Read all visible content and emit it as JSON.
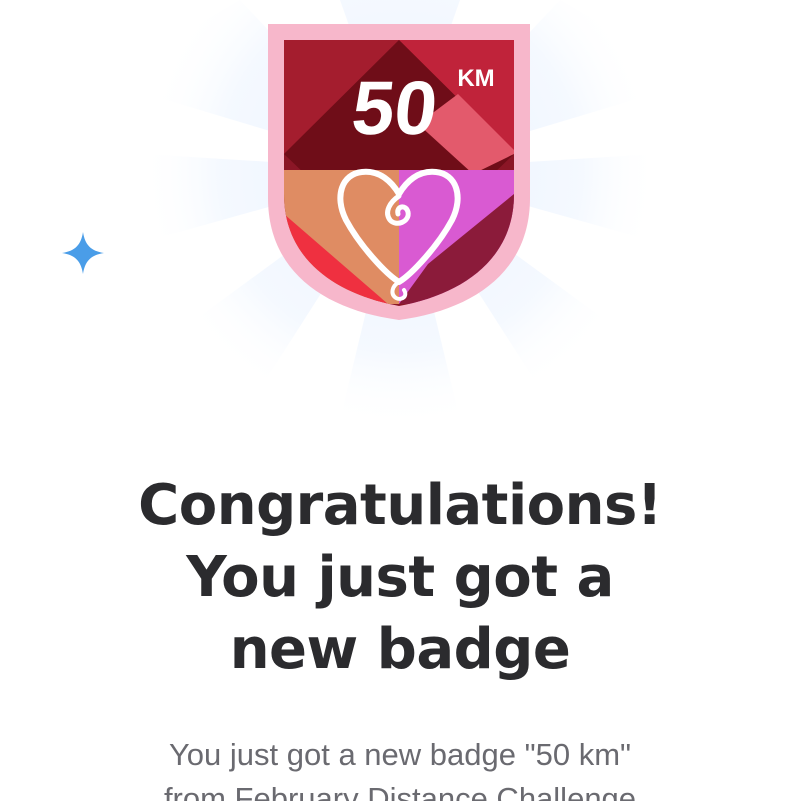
{
  "badge": {
    "distance": "50",
    "unit": "KM",
    "colors": {
      "frame": "#f7b7cb",
      "dark": "#6f0d18",
      "crimson": "#a41d2e",
      "rose": "#e35a6c",
      "peach": "#df8c63",
      "red": "#ef3040",
      "magenta": "#d95ad2",
      "heart": "#ffffff"
    }
  },
  "sparkle": {
    "icon": "sparkle-icon",
    "color": "#4a9de8"
  },
  "headline": {
    "line1": "Congratulations!",
    "line2": "You just got a",
    "line3": "new badge"
  },
  "subtext": {
    "line1": "You just got a new badge \"50 km\"",
    "line2": "from February Distance Challenge"
  }
}
